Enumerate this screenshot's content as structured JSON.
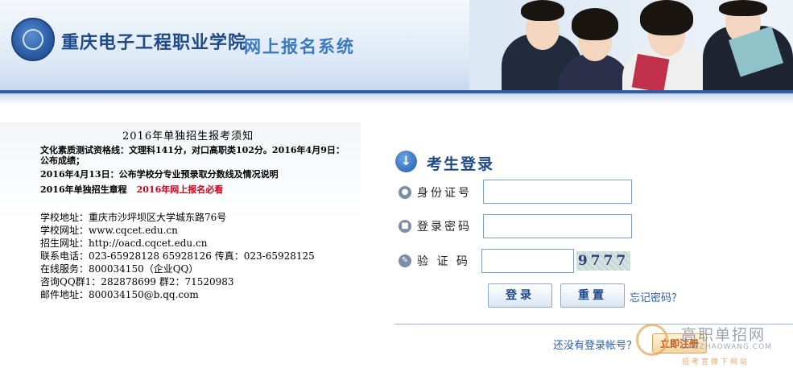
{
  "header": {
    "school_name": "重庆电子工程职业学院",
    "system_name": "网上报名系统"
  },
  "notice": {
    "title": "2016年单独招生报考须知",
    "line1": "文化素质测试资格线：文理科141分，对口高职类102分。2016年4月9日：",
    "line2": "公布成绩；",
    "line3": "2016年4月13日：公布学校分专业预录取分数线及情况说明",
    "line4_main": "2016年单独招生章程",
    "line4_red": "2016年网上报名必看"
  },
  "info": {
    "address": "学校地址：重庆市沙坪坝区大学城东路76号",
    "website": "学校网址：www.cqcet.edu.cn",
    "admission_site": "招生网址：http://oacd.cqcet.edu.cn",
    "phone": "联系电话：023-65928128 65928126 传真：023-65928125",
    "online_service": "在线服务：800034150（企业QQ）",
    "qq_groups": "咨询QQ群1：282878699    群2：71520983",
    "email": "邮件地址：800034150@b.qq.com"
  },
  "login": {
    "title": "考生登录",
    "id_label": "身份证号",
    "password_label": "登录密码",
    "captcha_label": "验 证 码",
    "id_value": "",
    "password_value": "",
    "captcha_value": "",
    "captcha_text": "9777",
    "login_button": "登录",
    "reset_button": "重置",
    "forgot_link": "忘记密码？",
    "no_account": "还没有登录帐号？",
    "register_button": "立即注册"
  },
  "watermark": {
    "title": "高职单招网",
    "url": "DANZHAOWANG.COM",
    "slogan": "招考官微下网站"
  },
  "icons": {
    "login_head": "arrow-down-circle-icon",
    "id_row": "user-icon",
    "password_row": "lock-icon",
    "captcha_row": "pencil-icon"
  },
  "colors": {
    "brand_blue": "#1f4a8a",
    "link_blue": "#2a5fa8",
    "alert_red": "#d0021b",
    "header_bar": "#2f5fa8"
  }
}
